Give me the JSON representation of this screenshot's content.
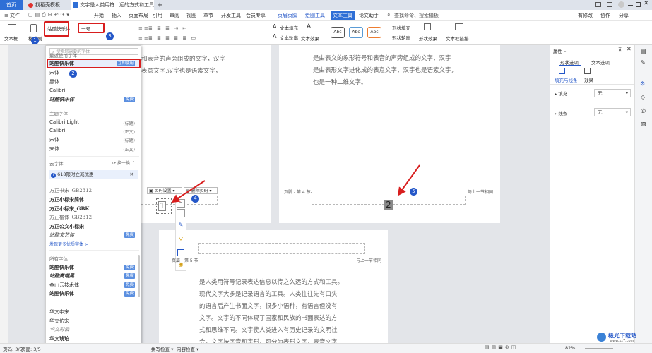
{
  "titlebar": {
    "tabs": [
      {
        "label": "首页"
      },
      {
        "label": "找稻壳模板"
      },
      {
        "label": "文字是人类用符...远的方式和工具"
      }
    ],
    "add": "+"
  },
  "menubar": {
    "file": "≡ 文件",
    "items": [
      "开始",
      "插入",
      "页面布局",
      "引用",
      "审阅",
      "视图",
      "章节",
      "开发工具",
      "会员专享",
      "页眉页脚",
      "绘图工具",
      "文本工具",
      "论文助手"
    ],
    "search_placeholder": "查找命令、搜索模板",
    "unsaved": "有修改",
    "share": "分享",
    "collab": "协作"
  },
  "ribbon": {
    "textbox": "文本框",
    "format_painter": "格式刷",
    "font_name": "站酷快乐体",
    "font_size": "一号",
    "style_buttons": [
      "Abc",
      "Abc",
      "Abc"
    ],
    "fill_label": "文本填充",
    "outline_label": "文本轮廓",
    "effect_label": "文本效果",
    "shape_fill": "形状填充",
    "shape_outline": "形状轮廓",
    "shape_effect": "形状效果",
    "textbox_link": "文本框链接"
  },
  "font_dropdown": {
    "search_placeholder": "搜索您需要的字体",
    "recent_header": "最近使用字体",
    "recent": [
      {
        "name": "站酷快乐体",
        "tag": "立即使用"
      },
      {
        "name": "宋体",
        "tag": ""
      },
      {
        "name": "黑体",
        "tag": ""
      },
      {
        "name": "Calibri",
        "tag": ""
      },
      {
        "name": "站酷快乐体",
        "tag": "免费"
      }
    ],
    "theme_header": "主题字体",
    "theme": [
      {
        "name": "Calibri Light",
        "tag": "(标题)"
      },
      {
        "name": "Calibri",
        "tag": "(正文)"
      },
      {
        "name": "宋体",
        "tag": "(标题)"
      },
      {
        "name": "宋体",
        "tag": "(正文)"
      }
    ],
    "cloud_header": "云字体",
    "cloud_refresh": "换一换",
    "promo": "618限时立减优惠",
    "cloud": [
      {
        "name": "方正书宋_GB2312"
      },
      {
        "name": "方正小标宋简体"
      },
      {
        "name": "方正小标宋_GBK"
      },
      {
        "name": "方正楷体_GB2312"
      },
      {
        "name": "方正公文小标宋"
      },
      {
        "name": "站酷文艺体",
        "tag": "免费"
      }
    ],
    "more_link": "发现更多优质字体 >",
    "all_header": "所有字体",
    "all": [
      {
        "name": "站酷快乐体",
        "tag": "免费"
      },
      {
        "name": "站酷高端黑",
        "tag": "免费"
      },
      {
        "name": "金山云技术体",
        "tag": "免费"
      },
      {
        "name": "站酷快乐体",
        "tag": "免费"
      },
      {
        "name": "华文中宋",
        "tag": ""
      },
      {
        "name": "华文仿宋",
        "tag": ""
      },
      {
        "name": "华文彩云",
        "tag": ""
      },
      {
        "name": "华文琥珀",
        "tag": ""
      }
    ]
  },
  "badges": [
    "1",
    "2",
    "3",
    "4",
    "5"
  ],
  "document": {
    "page2_lines": [
      "是由表文的象形符号和表音的声旁组成的文字，汉字",
      "是由表形文字进化成的表意文字，汉字也是语素文字，",
      "也是一种二维文字。"
    ],
    "page1_lines": [
      "和表音的声旁组成的文字，汉字",
      "表意文字,汉字也是语素文字，"
    ],
    "footer_labels": {
      "page1": "页脚 - 第 4 节-",
      "page2": "页脚 - 第 4 节-",
      "page2_right": "与上一节相同",
      "page3_header": "页眉 - 第 5 节-",
      "page3_header_right": "与上一节相同"
    },
    "page_number_1": "1",
    "page_number_2": "2",
    "footer_toolbar": {
      "page_settings": "页码设置",
      "delete_page": "删除页码"
    },
    "page3_lines": [
      "是人类用符号记录表达信息以传之久远的方式和工具。",
      "现代文字大多是记录语言的工具。人类往往先有口头",
      "的语言后产生书面文字，很多小语种，有语言但没有",
      "文字。文字的不同体现了国家和民族的书面表达的方",
      "式和思维不同。文字使人类进入有历史记录的文明社",
      "会。文字按字音和字形，可分为表形文字，表音文字"
    ]
  },
  "right_panel": {
    "title": "属性 ~",
    "tab_shape": "形状选项",
    "tab_text": "文本选项",
    "sub_fill": "填充与线条",
    "sub_effect": "效果",
    "fill_label": "填充",
    "fill_value": "无",
    "line_label": "线条",
    "line_value": "无"
  },
  "statusbar": {
    "page": "页码: 3/5",
    "pages": "页面: 3/5",
    "spell": "拼写检查 ▾",
    "content_check": "内容检查 ▾",
    "zoom": "82%"
  },
  "watermark": {
    "name": "极光下载站",
    "url": "www.xz7.com"
  },
  "colors": {
    "accent": "#2457c8",
    "red_box": "#d81e1e",
    "page_bg": "#ffffff",
    "canvas": "#e3e5e9"
  }
}
